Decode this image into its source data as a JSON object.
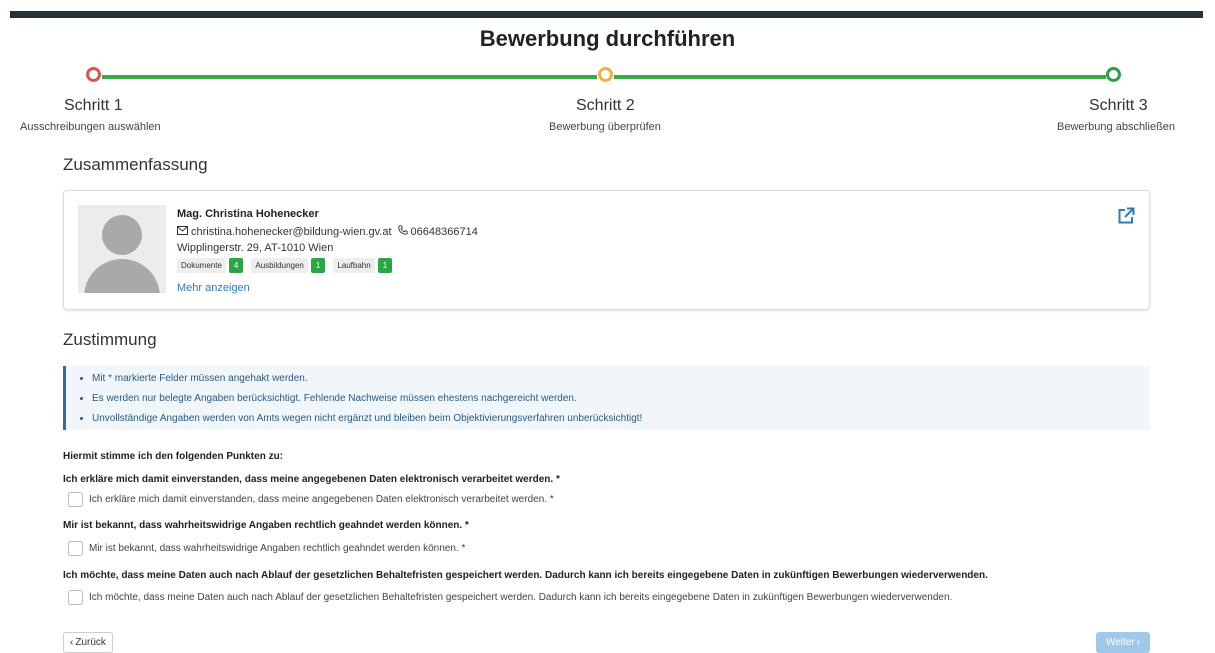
{
  "page": {
    "title": "Bewerbung durchführen"
  },
  "colors": {
    "step1": "#d9534f",
    "step2": "#f0ad4e",
    "step3": "#2e9e44",
    "line": "#3aa845",
    "link": "#337ab7",
    "badge": "#28a745"
  },
  "stepper": {
    "steps": [
      {
        "name": "Schritt 1",
        "desc": "Ausschreibungen auswählen"
      },
      {
        "name": "Schritt 2",
        "desc": "Bewerbung überprüfen"
      },
      {
        "name": "Schritt 3",
        "desc": "Bewerbung abschließen"
      }
    ]
  },
  "summary": {
    "heading": "Zusammenfassung",
    "name": "Mag. Christina Hohenecker",
    "email": "christina.hohenecker@bildung-wien.gv.at",
    "phone": "06648366714",
    "address": "Wipplingerstr. 29, AT-1010 Wien",
    "badges": [
      {
        "label": "Dokumente",
        "count": "4"
      },
      {
        "label": "Ausbildungen",
        "count": "1"
      },
      {
        "label": "Laufbahn",
        "count": "1"
      }
    ],
    "more": "Mehr anzeigen"
  },
  "consent": {
    "heading": "Zustimmung",
    "notes": [
      "Mit * markierte Felder müssen angehakt werden.",
      "Es werden nur belegte Angaben berücksichtigt. Fehlende Nachweise müssen ehestens nachgereicht werden.",
      "Unvollständige Angaben werden von Amts wegen nicht ergänzt und bleiben beim Objektivierungsverfahren unberücksichtigt!"
    ],
    "lead": "Hiermit stimme ich den folgenden Punkten zu:",
    "items": [
      {
        "title": "Ich erkläre mich damit einverstanden, dass meine angegebenen Daten elektronisch verarbeitet werden. *",
        "label": "Ich erkläre mich damit einverstanden, dass meine angegebenen Daten elektronisch verarbeitet werden. *"
      },
      {
        "title": "Mir ist bekannt, dass wahrheitswidrige Angaben rechtlich geahndet werden können. *",
        "label": "Mir ist bekannt, dass wahrheitswidrige Angaben rechtlich geahndet werden können. *"
      },
      {
        "title": "Ich möchte, dass meine Daten auch nach Ablauf der gesetzlichen Behaltefristen gespeichert werden. Dadurch kann ich bereits eingegebene Daten in zukünftigen Bewerbungen wiederverwenden.",
        "label": "Ich möchte, dass meine Daten auch nach Ablauf der gesetzlichen Behaltefristen gespeichert werden. Dadurch kann ich bereits eingegebene Daten in zukünftigen Bewerbungen wiederverwenden."
      }
    ]
  },
  "nav": {
    "back": "Zurück",
    "next": "Weiter"
  }
}
